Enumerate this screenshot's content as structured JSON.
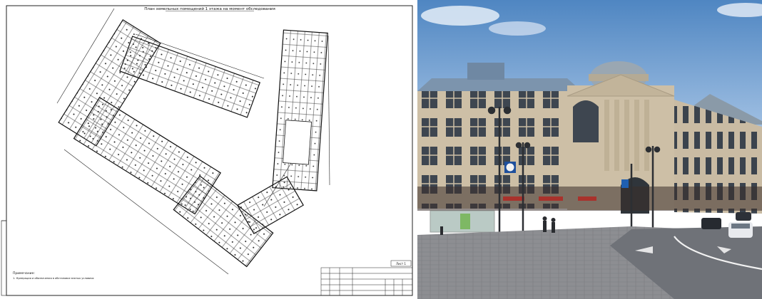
{
  "plan": {
    "title": "План земельных помещений 1 этажа на момент обследования",
    "notes_heading": "Примечание:",
    "notes_line": "1. Нумерация и обозначения в обстановке взятых условиях",
    "sheet_label": "Лист 1"
  },
  "photo": {
    "clock_face": "",
    "road_sign": "",
    "colors": {
      "sky_top": "#4f86c2",
      "sky_bottom": "#a9c6e6",
      "facade": "#cdbfa6",
      "roof": "#7c94ad",
      "street": "#6f7278"
    }
  }
}
